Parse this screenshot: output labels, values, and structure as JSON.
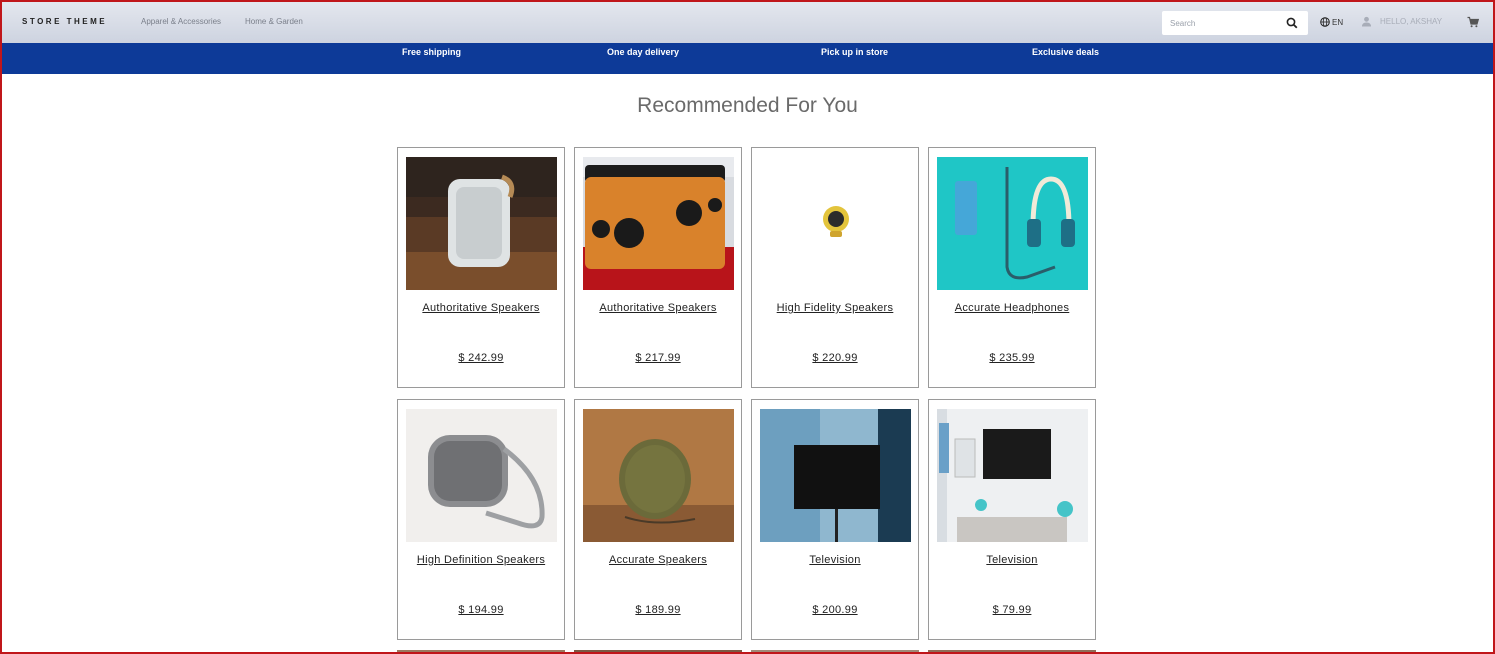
{
  "header": {
    "logo": "STORE THEME",
    "nav": [
      "Apparel & Accessories",
      "Home & Garden"
    ],
    "search_placeholder": "Search",
    "language": "EN",
    "greeting": "HELLO, AKSHAY"
  },
  "benefits": [
    "Free shipping",
    "One day delivery",
    "Pick up in store",
    "Exclusive deals"
  ],
  "section_title": "Recommended For You",
  "products": [
    {
      "name": "Authoritative Speakers",
      "price": "$ 242.99",
      "image": "white-portable-speaker"
    },
    {
      "name": "Authoritative Speakers",
      "price": "$ 217.99",
      "image": "bamboo-speaker"
    },
    {
      "name": "High Fidelity Speakers",
      "price": "$ 220.99",
      "image": "yellow-mini-speaker"
    },
    {
      "name": "Accurate Headphones",
      "price": "$ 235.99",
      "image": "headphones-on-teal"
    },
    {
      "name": "High Definition Speakers",
      "price": "$ 194.99",
      "image": "grey-speaker-strap"
    },
    {
      "name": "Accurate Speakers",
      "price": "$ 189.99",
      "image": "olive-round-speaker"
    },
    {
      "name": "Television",
      "price": "$ 200.99",
      "image": "tv-on-stand"
    },
    {
      "name": "Television",
      "price": "$ 79.99",
      "image": "tv-living-room"
    }
  ],
  "colors": {
    "benefit_bar": "#0d3a98",
    "frame": "#c0161a"
  }
}
